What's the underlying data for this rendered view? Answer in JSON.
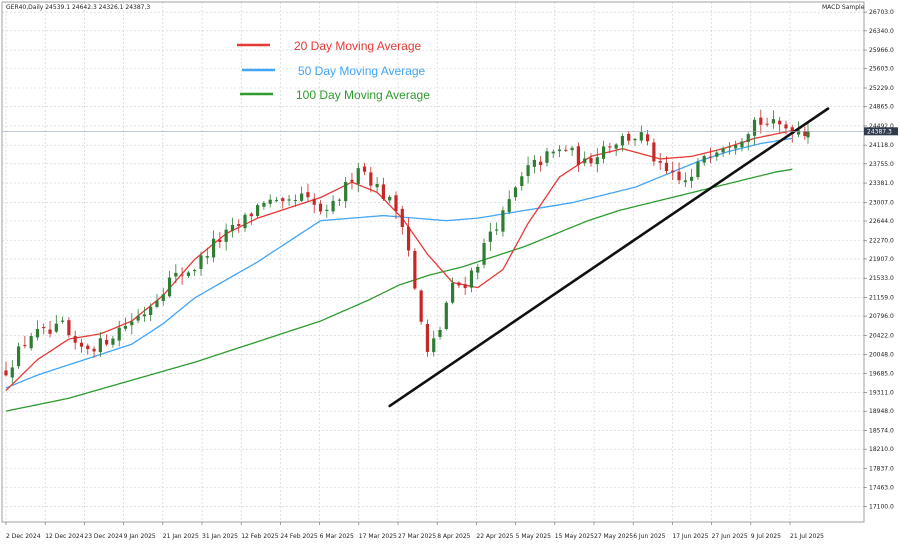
{
  "header": {
    "symbol_line": "GER40,Daily  24539.1 24642.3 24326.1 24387.3",
    "indicator_name": "MACD Sample"
  },
  "colors": {
    "bull": "#2e7d32",
    "bear": "#c62828",
    "ma20": "#e53935",
    "ma50": "#42a5f5",
    "ma100": "#2e9b2e",
    "trendline": "#111111",
    "grid": "#c9cfd8",
    "price_tag": "#2f3b4c"
  },
  "chart_data": {
    "type": "candlestick",
    "title": "",
    "xlabel": "",
    "ylabel": "",
    "ylim": [
      16795,
      26900
    ],
    "grid": true,
    "legend_placement": "top-left",
    "current_price_label": "24387.3",
    "y_ticks": [
      "26703.0",
      "26340.0",
      "25966.0",
      "25603.0",
      "25229.0",
      "24865.0",
      "24492.0",
      "24118.0",
      "23755.0",
      "23381.0",
      "23007.0",
      "22644.0",
      "22270.0",
      "21907.0",
      "21533.0",
      "21159.0",
      "20796.0",
      "20422.0",
      "20048.0",
      "19685.0",
      "19311.0",
      "18948.0",
      "18574.0",
      "18210.0",
      "17837.0",
      "17463.0",
      "17100.0"
    ],
    "x_ticks": [
      "2 Dec 2024",
      "12 Dec 2024",
      "23 Dec 2024",
      "9 Jan 2025",
      "21 Jan 2025",
      "31 Jan 2025",
      "12 Feb 2025",
      "24 Feb 2025",
      "6 Mar 2025",
      "17 Mar 2025",
      "27 Mar 2025",
      "8 Apr 2025",
      "22 Apr 2025",
      "5 May 2025",
      "15 May 2025",
      "27 May 2025",
      "6 Jun 2025",
      "17 Jun 2025",
      "27 Jun 2025",
      "9 Jul 2025",
      "21 Jul 2025"
    ],
    "series": [
      {
        "name": "20 Day Moving Average",
        "key": "ma20"
      },
      {
        "name": "50 Day Moving Average",
        "key": "ma50"
      },
      {
        "name": "100 Day Moving Average",
        "key": "ma100"
      }
    ],
    "n_bars": 168,
    "close_anchors": [
      [
        0,
        19750
      ],
      [
        8,
        20450
      ],
      [
        14,
        20450
      ],
      [
        18,
        20600
      ],
      [
        22,
        20150
      ],
      [
        30,
        20250
      ],
      [
        36,
        20550
      ],
      [
        44,
        20880
      ],
      [
        52,
        21500
      ],
      [
        60,
        21750
      ],
      [
        66,
        22200
      ],
      [
        74,
        22550
      ],
      [
        82,
        23050
      ],
      [
        88,
        22900
      ],
      [
        94,
        23100
      ],
      [
        102,
        22750
      ],
      [
        108,
        23300
      ],
      [
        112,
        23750
      ],
      [
        118,
        23300
      ],
      [
        125,
        22800
      ],
      [
        127,
        22500
      ],
      [
        130,
        21300
      ],
      [
        132,
        20650
      ],
      [
        134,
        20050
      ],
      [
        136,
        20300
      ],
      [
        138,
        20550
      ],
      [
        140,
        21050
      ],
      [
        142,
        21350
      ],
      [
        146,
        21450
      ],
      [
        150,
        21850
      ],
      [
        154,
        22450
      ],
      [
        158,
        22750
      ],
      [
        162,
        23250
      ],
      [
        166,
        23650
      ],
      [
        172,
        23900
      ],
      [
        178,
        24050
      ],
      [
        184,
        23750
      ],
      [
        190,
        24100
      ],
      [
        196,
        24250
      ],
      [
        202,
        24300
      ],
      [
        208,
        23650
      ],
      [
        214,
        23400
      ],
      [
        218,
        23450
      ],
      [
        222,
        23950
      ],
      [
        228,
        24150
      ],
      [
        234,
        24300
      ],
      [
        238,
        24600
      ],
      [
        244,
        24500
      ],
      [
        250,
        24450
      ],
      [
        255,
        24387
      ]
    ],
    "ma_anchors": {
      "ma20": [
        [
          0,
          19350
        ],
        [
          10,
          19950
        ],
        [
          20,
          20350
        ],
        [
          30,
          20450
        ],
        [
          40,
          20700
        ],
        [
          50,
          21200
        ],
        [
          60,
          21900
        ],
        [
          70,
          22400
        ],
        [
          80,
          22700
        ],
        [
          90,
          22900
        ],
        [
          100,
          23100
        ],
        [
          110,
          23400
        ],
        [
          118,
          23200
        ],
        [
          126,
          22700
        ],
        [
          134,
          22000
        ],
        [
          142,
          21450
        ],
        [
          150,
          21350
        ],
        [
          158,
          21700
        ],
        [
          166,
          22600
        ],
        [
          176,
          23500
        ],
        [
          186,
          23900
        ],
        [
          196,
          24050
        ],
        [
          208,
          23850
        ],
        [
          218,
          23900
        ],
        [
          228,
          24050
        ],
        [
          238,
          24250
        ],
        [
          250,
          24400
        ]
      ],
      "ma50": [
        [
          0,
          19400
        ],
        [
          10,
          19650
        ],
        [
          20,
          19850
        ],
        [
          30,
          20050
        ],
        [
          40,
          20250
        ],
        [
          50,
          20650
        ],
        [
          60,
          21150
        ],
        [
          70,
          21500
        ],
        [
          80,
          21850
        ],
        [
          90,
          22250
        ],
        [
          100,
          22650
        ],
        [
          110,
          22700
        ],
        [
          120,
          22750
        ],
        [
          130,
          22700
        ],
        [
          140,
          22650
        ],
        [
          150,
          22700
        ],
        [
          160,
          22800
        ],
        [
          170,
          22900
        ],
        [
          180,
          23000
        ],
        [
          190,
          23150
        ],
        [
          200,
          23300
        ],
        [
          210,
          23550
        ],
        [
          220,
          23800
        ],
        [
          230,
          24000
        ],
        [
          240,
          24150
        ],
        [
          250,
          24250
        ]
      ],
      "ma100": [
        [
          0,
          18950
        ],
        [
          20,
          19200
        ],
        [
          40,
          19550
        ],
        [
          60,
          19900
        ],
        [
          80,
          20300
        ],
        [
          100,
          20700
        ],
        [
          115,
          21100
        ],
        [
          125,
          21400
        ],
        [
          135,
          21600
        ],
        [
          145,
          21750
        ],
        [
          155,
          21950
        ],
        [
          165,
          22150
        ],
        [
          175,
          22400
        ],
        [
          185,
          22650
        ],
        [
          195,
          22850
        ],
        [
          205,
          23000
        ],
        [
          215,
          23150
        ],
        [
          225,
          23300
        ],
        [
          235,
          23450
        ],
        [
          245,
          23600
        ],
        [
          250,
          23650
        ]
      ]
    },
    "trendline": {
      "from": {
        "bar": 122,
        "price": 19050
      },
      "to": {
        "bar": 255,
        "price": 24750
      }
    }
  }
}
